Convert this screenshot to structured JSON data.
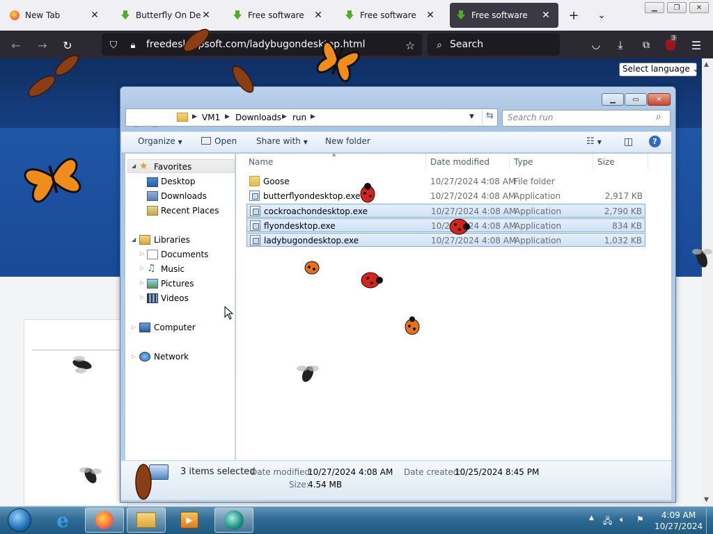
{
  "browser": {
    "tabs": [
      {
        "title": "New Tab",
        "favicon": "firefox-icon",
        "active": false
      },
      {
        "title": "Butterfly On Desktop",
        "favicon": "download-arrow-icon",
        "active": false
      },
      {
        "title": "Free software",
        "favicon": "download-arrow-icon",
        "active": false
      },
      {
        "title": "Free software",
        "favicon": "download-arrow-icon",
        "active": false
      },
      {
        "title": "Free software",
        "favicon": "download-arrow-icon",
        "active": true
      }
    ],
    "new_tab": "+",
    "tab_list": "⌄",
    "url": "freedesktopsoft.com/ladybugondesktop.html",
    "search_placeholder": "Search",
    "extension_badge": "3"
  },
  "site": {
    "language_select": "Select language"
  },
  "explorer": {
    "breadcrumb": [
      "VM1",
      "Downloads",
      "run"
    ],
    "search_placeholder": "Search run",
    "toolbar": {
      "organize": "Organize",
      "open": "Open",
      "share_with": "Share with",
      "new_folder": "New folder"
    },
    "nav": {
      "favorites": "Favorites",
      "desktop": "Desktop",
      "downloads": "Downloads",
      "recent_places": "Recent Places",
      "libraries": "Libraries",
      "documents": "Documents",
      "music": "Music",
      "pictures": "Pictures",
      "videos": "Videos",
      "computer": "Computer",
      "network": "Network"
    },
    "columns": {
      "name": "Name",
      "date_modified": "Date modified",
      "type": "Type",
      "size": "Size"
    },
    "files": [
      {
        "name": "Goose",
        "date": "10/27/2024 4:08 AM",
        "type": "File folder",
        "size": "",
        "kind": "folder",
        "selected": false
      },
      {
        "name": "butterflyondesktop.exe",
        "date": "10/27/2024 4:08 AM",
        "type": "Application",
        "size": "2,917 KB",
        "kind": "app",
        "selected": false
      },
      {
        "name": "cockroachondesktop.exe",
        "date": "10/27/2024 4:08 AM",
        "type": "Application",
        "size": "2,790 KB",
        "kind": "app",
        "selected": true
      },
      {
        "name": "flyondesktop.exe",
        "date": "10/27/2024 4:08 AM",
        "type": "Application",
        "size": "834 KB",
        "kind": "app",
        "selected": true
      },
      {
        "name": "ladybugondesktop.exe",
        "date": "10/27/2024 4:08 AM",
        "type": "Application",
        "size": "1,032 KB",
        "kind": "app",
        "selected": true
      }
    ],
    "details": {
      "selection": "3 items selected",
      "date_modified_label": "Date modified:",
      "date_modified": "10/27/2024 4:08 AM",
      "date_created_label": "Date created:",
      "date_created": "10/25/2024 8:45 PM",
      "size_label": "Size:",
      "size": "4.54 MB"
    }
  },
  "taskbar": {
    "time": "4:09 AM",
    "date": "10/27/2024"
  },
  "colors": {
    "firefox_dark": "#2b2a33",
    "site_blue": "#1f56a6",
    "selection": "#cfe2f7",
    "taskbar": "#2f6b93"
  }
}
